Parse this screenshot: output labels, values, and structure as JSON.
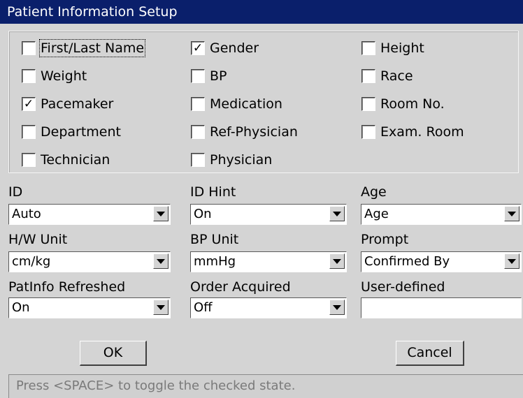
{
  "window": {
    "title": "Patient Information Setup"
  },
  "checkboxes": [
    {
      "label": "First/Last Name",
      "checked": false
    },
    {
      "label": "Gender",
      "checked": true
    },
    {
      "label": "Height",
      "checked": false
    },
    {
      "label": "Weight",
      "checked": false
    },
    {
      "label": "BP",
      "checked": false
    },
    {
      "label": "Race",
      "checked": false
    },
    {
      "label": "Pacemaker",
      "checked": true
    },
    {
      "label": "Medication",
      "checked": false
    },
    {
      "label": "Room No.",
      "checked": false
    },
    {
      "label": "Department",
      "checked": false
    },
    {
      "label": "Ref-Physician",
      "checked": false
    },
    {
      "label": "Exam. Room",
      "checked": false
    },
    {
      "label": "Technician",
      "checked": false
    },
    {
      "label": "Physician",
      "checked": false
    }
  ],
  "check_glyph": "✓",
  "fields": {
    "id": {
      "label": "ID",
      "value": "Auto"
    },
    "id_hint": {
      "label": "ID Hint",
      "value": "On"
    },
    "age": {
      "label": "Age",
      "value": "Age"
    },
    "hw_unit": {
      "label": "H/W Unit",
      "value": "cm/kg"
    },
    "bp_unit": {
      "label": "BP Unit",
      "value": "mmHg"
    },
    "prompt": {
      "label": "Prompt",
      "value": "Confirmed By"
    },
    "patinfo_refreshed": {
      "label": "PatInfo Refreshed",
      "value": "On"
    },
    "order_acquired": {
      "label": "Order Acquired",
      "value": "Off"
    },
    "user_defined": {
      "label": "User-defined",
      "value": ""
    }
  },
  "buttons": {
    "ok": "OK",
    "cancel": "Cancel"
  },
  "status": {
    "text": "Press <SPACE> to toggle the checked state."
  },
  "colors": {
    "titlebar": "#0a1f6b",
    "background": "#d4d4d4",
    "status_text": "#7a7a7a"
  }
}
